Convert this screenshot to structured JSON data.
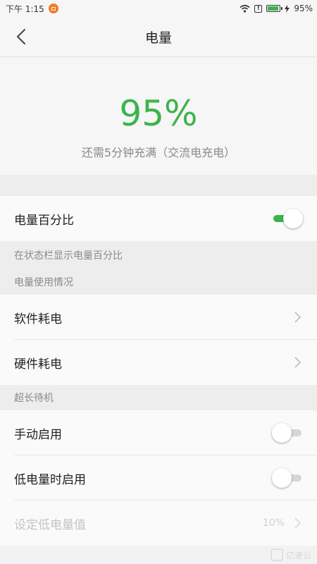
{
  "status_bar": {
    "time": "下午 1:15",
    "battery_percent": "95%",
    "battery_level": 0.95,
    "alert_glyph": "!"
  },
  "header": {
    "title": "电量",
    "back_icon": "chevron-left-icon"
  },
  "summary": {
    "percent": "95%",
    "charging_text": "还需5分钟充满（交流电充电）"
  },
  "battery_percentage": {
    "label": "电量百分比",
    "enabled": true,
    "hint": "在状态栏显示电量百分比"
  },
  "usage_section": {
    "title": "电量使用情况",
    "items": [
      {
        "label": "软件耗电"
      },
      {
        "label": "硬件耗电"
      }
    ]
  },
  "standby_section": {
    "title": "超长待机",
    "manual": {
      "label": "手动启用",
      "enabled": false
    },
    "low_battery": {
      "label": "低电量时启用",
      "enabled": false
    },
    "threshold": {
      "label": "设定低电量值",
      "value": "10%"
    }
  },
  "watermark": {
    "text": "亿速云"
  },
  "colors": {
    "accent": "#3cb44b",
    "text_secondary": "#8a8a8a",
    "background": "#f2f2f2"
  }
}
